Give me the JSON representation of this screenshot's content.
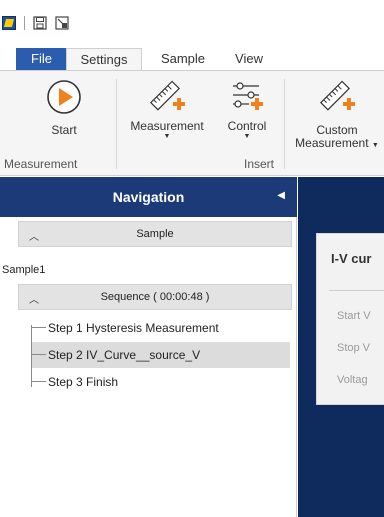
{
  "tabs": {
    "file": "File",
    "settings": "Settings",
    "sample": "Sample",
    "view": "View"
  },
  "ribbon": {
    "start": "Start",
    "measurement": "Measurement",
    "control": "Control",
    "custom_line1": "Custom",
    "custom_line2": "Measurement",
    "group_measurement": "Measurement",
    "group_insert": "Insert"
  },
  "navigation": {
    "title": "Navigation",
    "sample_header": "Sample",
    "sample_name": "Sample1",
    "sequence_header": "Sequence ( 00:00:48 )",
    "steps": [
      {
        "label": "Step 1 Hysteresis Measurement",
        "selected": false
      },
      {
        "label": "Step 2 IV_Curve__source_V",
        "selected": true
      },
      {
        "label": "Step 3 Finish",
        "selected": false
      }
    ]
  },
  "detail": {
    "title": "I-V cur",
    "fields": [
      "Start V",
      "Stop V",
      "Voltag"
    ]
  },
  "colors": {
    "nav_header": "#1d3a78",
    "content_bg": "#0f2a5c",
    "file_tab": "#2b5cad",
    "start_accent": "#f0821e"
  },
  "icons": {
    "app": "app-logo-icon",
    "save": "save-icon",
    "settings": "screen-settings-icon",
    "start": "play-icon",
    "measurement": "ruler-plus-icon",
    "control": "sliders-plus-icon",
    "custom": "ruler-plus-icon"
  }
}
